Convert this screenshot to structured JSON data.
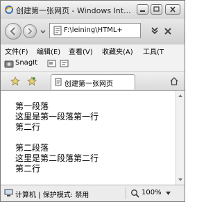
{
  "window": {
    "title": "创建第一张网页 - Windows Int..."
  },
  "address_bar": {
    "url": "F:\\leining\\HTML+"
  },
  "menu": {
    "items": [
      "文件(F)",
      "编辑(E)",
      "查看(V)",
      "收藏夹(A)",
      "工具(T"
    ]
  },
  "links_bar": {
    "snagit_label": "SnagIt"
  },
  "tab": {
    "title": "创建第一张网页"
  },
  "content": {
    "paragraphs": [
      [
        "第一段落",
        "这里是第一段落第一行",
        "第二行"
      ],
      [
        "第二段落",
        "这里是第二段落第二行",
        "第二行"
      ]
    ]
  },
  "status_bar": {
    "zone_text": "计算机 | 保护模式: 禁用",
    "zoom": "100%"
  }
}
